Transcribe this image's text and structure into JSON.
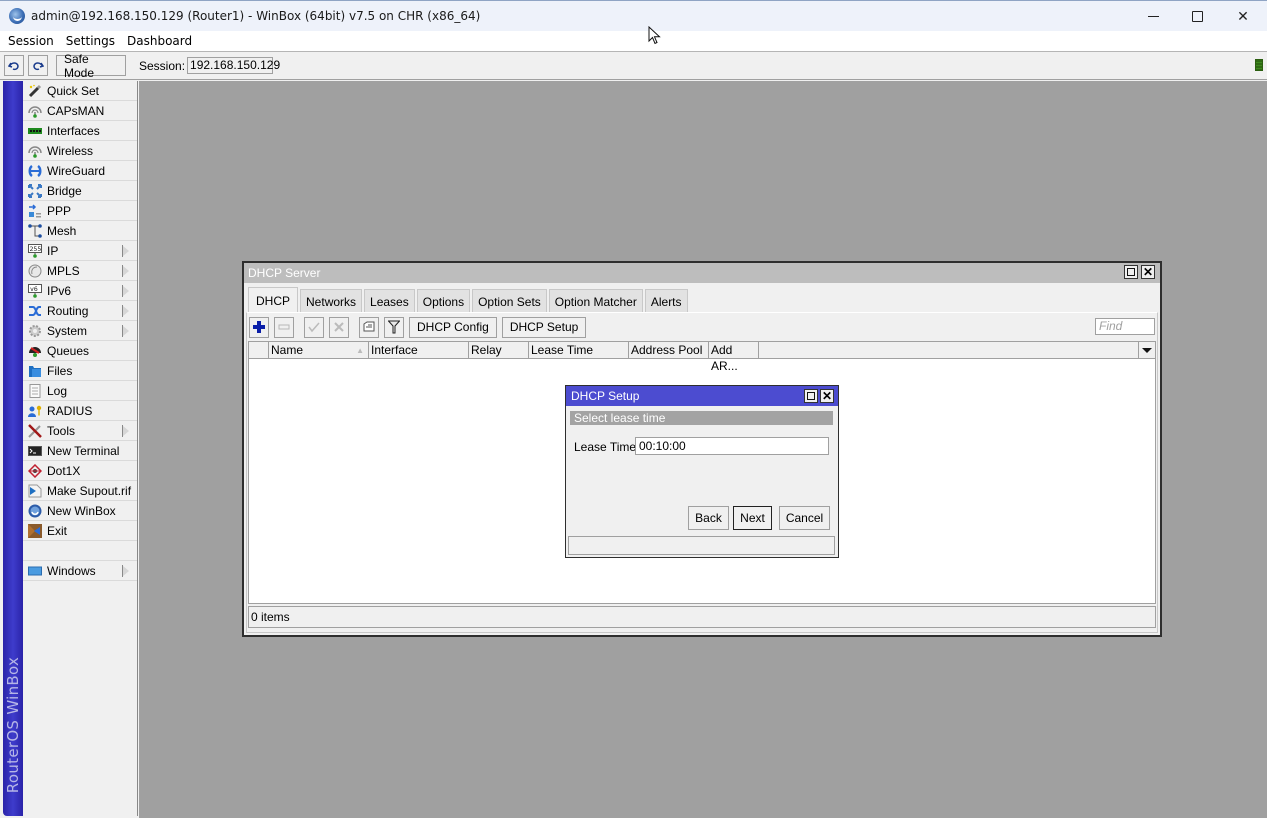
{
  "window": {
    "title": "admin@192.168.150.129 (Router1) - WinBox (64bit) v7.5 on CHR (x86_64)",
    "controls": [
      "minimize",
      "maximize",
      "close"
    ]
  },
  "menubar": {
    "items": [
      "Session",
      "Settings",
      "Dashboard"
    ]
  },
  "toolbar": {
    "undo_icon": "undo-icon",
    "redo_icon": "redo-icon",
    "safe_mode_label": "Safe Mode",
    "session_label": "Session:",
    "session_value": "192.168.150.129",
    "indicator_color": "#2f6a14"
  },
  "sidebar": {
    "brand_text": "RouterOS WinBox",
    "brand_color": "#3633b8",
    "items": [
      {
        "label": "Quick Set",
        "icon": "wand-icon",
        "submenu": false
      },
      {
        "label": "CAPsMAN",
        "icon": "antenna-icon",
        "submenu": false
      },
      {
        "label": "Interfaces",
        "icon": "network-card-icon",
        "submenu": false
      },
      {
        "label": "Wireless",
        "icon": "antenna-icon",
        "submenu": false
      },
      {
        "label": "WireGuard",
        "icon": "wireguard-icon",
        "submenu": false
      },
      {
        "label": "Bridge",
        "icon": "bridge-icon",
        "submenu": false
      },
      {
        "label": "PPP",
        "icon": "ppp-icon",
        "submenu": false
      },
      {
        "label": "Mesh",
        "icon": "mesh-icon",
        "submenu": false
      },
      {
        "label": "IP",
        "icon": "ip-icon",
        "submenu": true
      },
      {
        "label": "MPLS",
        "icon": "mpls-icon",
        "submenu": true
      },
      {
        "label": "IPv6",
        "icon": "ipv6-icon",
        "submenu": true
      },
      {
        "label": "Routing",
        "icon": "routing-icon",
        "submenu": true
      },
      {
        "label": "System",
        "icon": "gear-icon",
        "submenu": true
      },
      {
        "label": "Queues",
        "icon": "queues-icon",
        "submenu": false
      },
      {
        "label": "Files",
        "icon": "folder-icon",
        "submenu": false
      },
      {
        "label": "Log",
        "icon": "log-icon",
        "submenu": false
      },
      {
        "label": "RADIUS",
        "icon": "radius-icon",
        "submenu": false
      },
      {
        "label": "Tools",
        "icon": "tools-icon",
        "submenu": true
      },
      {
        "label": "New Terminal",
        "icon": "terminal-icon",
        "submenu": false
      },
      {
        "label": "Dot1X",
        "icon": "dot1x-icon",
        "submenu": false
      },
      {
        "label": "Make Supout.rif",
        "icon": "supout-icon",
        "submenu": false
      },
      {
        "label": "New WinBox",
        "icon": "winbox-icon",
        "submenu": false
      },
      {
        "label": "Exit",
        "icon": "exit-icon",
        "submenu": false
      }
    ],
    "bottom_items": [
      {
        "label": "Windows",
        "icon": "windows-icon",
        "submenu": true
      }
    ]
  },
  "dhcp_server": {
    "title": "DHCP Server",
    "tabs": [
      {
        "label": "DHCP",
        "active": true
      },
      {
        "label": "Networks",
        "active": false
      },
      {
        "label": "Leases",
        "active": false
      },
      {
        "label": "Options",
        "active": false
      },
      {
        "label": "Option Sets",
        "active": false
      },
      {
        "label": "Option Matcher",
        "active": false
      },
      {
        "label": "Alerts",
        "active": false
      }
    ],
    "toolbar": {
      "add_icon": "plus-icon",
      "remove_icon": "minus-icon",
      "enable_icon": "check-icon",
      "disable_icon": "x-icon",
      "comment_icon": "comment-icon",
      "filter_icon": "filter-icon",
      "dhcp_config_label": "DHCP Config",
      "dhcp_setup_label": "DHCP Setup",
      "find_placeholder": "Find"
    },
    "columns": [
      "Name",
      "Interface",
      "Relay",
      "Lease Time",
      "Address Pool",
      "Add AR..."
    ],
    "rows": [],
    "status": "0 items"
  },
  "dhcp_setup": {
    "title": "DHCP Setup",
    "step": "Select lease time",
    "lease_time_label": "Lease Time:",
    "lease_time_value": "00:10:00",
    "back_label": "Back",
    "next_label": "Next",
    "cancel_label": "Cancel",
    "titlebar_color": "#4c4cd0"
  }
}
